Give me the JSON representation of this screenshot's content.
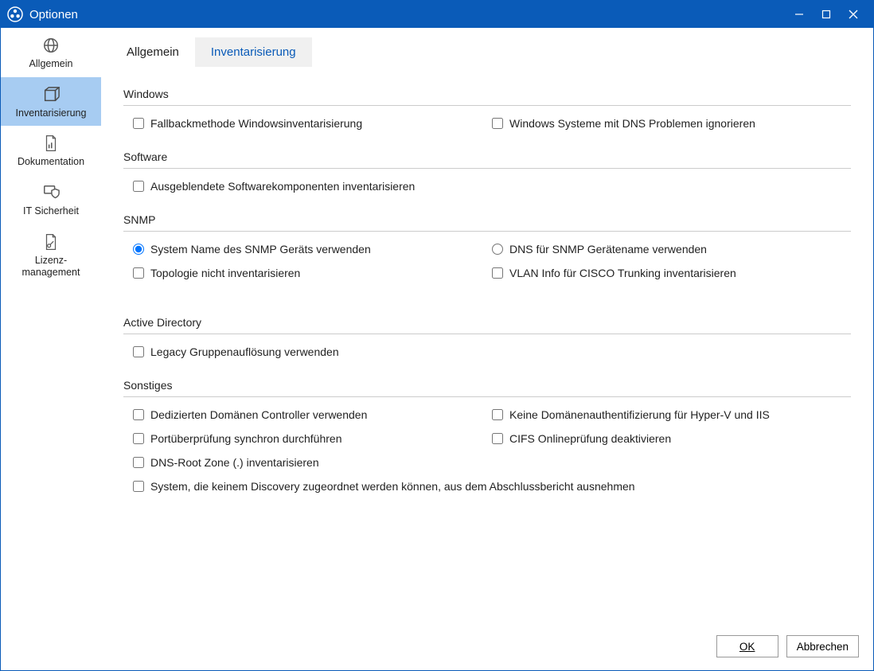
{
  "window": {
    "title": "Optionen"
  },
  "sidebar": {
    "items": [
      {
        "label": "Allgemein"
      },
      {
        "label": "Inventarisierung"
      },
      {
        "label": "Dokumentation"
      },
      {
        "label": "IT Sicherheit"
      },
      {
        "label": "Lizenz-\nmanagement"
      }
    ]
  },
  "tabs": {
    "general": "Allgemein",
    "inventory": "Inventarisierung"
  },
  "sections": {
    "windows": {
      "title": "Windows",
      "fallback": "Fallbackmethode Windowsinventarisierung",
      "dns_ignore": "Windows Systeme mit DNS Problemen ignorieren"
    },
    "software": {
      "title": "Software",
      "hidden": "Ausgeblendete Softwarekomponenten inventarisieren"
    },
    "snmp": {
      "title": "SNMP",
      "sysname": "System Name des SNMP Geräts verwenden",
      "dnsname": "DNS für SNMP Gerätename verwenden",
      "topo": "Topologie nicht inventarisieren",
      "vlan": "VLAN Info für CISCO Trunking inventarisieren"
    },
    "ad": {
      "title": "Active Directory",
      "legacy": "Legacy Gruppenauflösung verwenden"
    },
    "misc": {
      "title": "Sonstiges",
      "ded_dc": "Dedizierten Domänen Controller verwenden",
      "no_auth": "Keine Domänenauthentifizierung für Hyper-V und IIS",
      "port_sync": "Portüberprüfung synchron durchführen",
      "cifs": "CIFS Onlineprüfung deaktivieren",
      "dns_root": "DNS-Root Zone (.) inventarisieren",
      "exclude": "System, die keinem Discovery zugeordnet werden können, aus dem Abschlussbericht ausnehmen"
    }
  },
  "footer": {
    "ok": "OK",
    "cancel": "Abbrechen"
  }
}
